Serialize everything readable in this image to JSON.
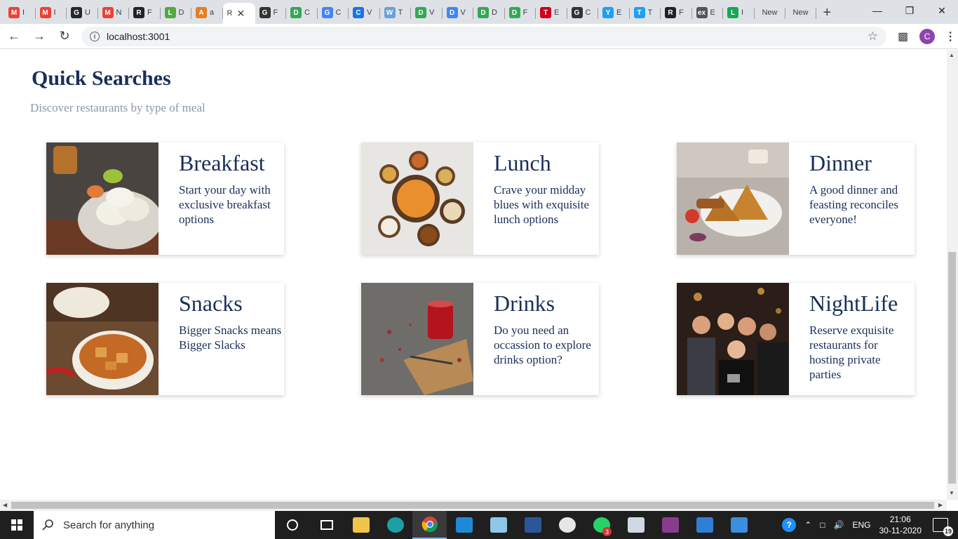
{
  "browser": {
    "tabs": [
      {
        "title": "I",
        "fav": "gmail-icon",
        "color": "#ea4335",
        "letter": "M"
      },
      {
        "title": "I",
        "fav": "gmail-icon",
        "color": "#ea4335",
        "letter": "M"
      },
      {
        "title": "U",
        "fav": "github-icon",
        "color": "#24292e",
        "letter": "G"
      },
      {
        "title": "N",
        "fav": "gmail-icon",
        "color": "#ea4335",
        "letter": "M"
      },
      {
        "title": "F",
        "fav": "react-icon",
        "color": "#20232a",
        "letter": "R"
      },
      {
        "title": "D",
        "fav": "mongodb-icon",
        "color": "#4faa41",
        "letter": "L"
      },
      {
        "title": "a",
        "fav": "grid-icon",
        "color": "#e67e22",
        "letter": "A"
      },
      {
        "title": "R",
        "fav": "none",
        "color": "#ffffff",
        "letter": "",
        "active": true
      },
      {
        "title": "F",
        "fav": "globe-icon",
        "color": "#333333",
        "letter": "G"
      },
      {
        "title": "C",
        "fav": "drive-icon",
        "color": "#34a853",
        "letter": "D"
      },
      {
        "title": "C",
        "fav": "google-icon",
        "color": "#4285f4",
        "letter": "G"
      },
      {
        "title": "V",
        "fav": "contacts-icon",
        "color": "#1a73e8",
        "letter": "C"
      },
      {
        "title": "T",
        "fav": "whiteboard-icon",
        "color": "#6aa0d8",
        "letter": "W"
      },
      {
        "title": "V",
        "fav": "drive-icon",
        "color": "#34a853",
        "letter": "D"
      },
      {
        "title": "V",
        "fav": "docs-icon",
        "color": "#4285f4",
        "letter": "D"
      },
      {
        "title": "D",
        "fav": "drive-icon",
        "color": "#34a853",
        "letter": "D"
      },
      {
        "title": "F",
        "fav": "drive-icon",
        "color": "#34a853",
        "letter": "D"
      },
      {
        "title": "E",
        "fav": "tools-icon",
        "color": "#d0021b",
        "letter": "T"
      },
      {
        "title": "C",
        "fav": "globe-icon",
        "color": "#333333",
        "letter": "G"
      },
      {
        "title": "E",
        "fav": "bolt-icon",
        "color": "#1da1f2",
        "letter": "Y"
      },
      {
        "title": "T",
        "fav": "t-icon",
        "color": "#1da1f2",
        "letter": "T"
      },
      {
        "title": "F",
        "fav": "react-icon",
        "color": "#20232a",
        "letter": "R"
      },
      {
        "title": "E",
        "fav": "express-icon",
        "color": "#555555",
        "letter": "ex"
      },
      {
        "title": "I",
        "fav": "mongodb-icon",
        "color": "#13aa52",
        "letter": "L"
      }
    ],
    "new_tabs": [
      "New",
      "New"
    ],
    "url": "localhost:3001",
    "profile_initial": "C"
  },
  "page": {
    "title": "Quick Searches",
    "subtitle": "Discover restaurants by type of meal",
    "cards": [
      {
        "title": "Breakfast",
        "desc": "Start your day with exclusive breakfast options",
        "image": "breakfast-photo"
      },
      {
        "title": "Lunch",
        "desc": "Crave your midday blues with exquisite lunch options",
        "image": "lunch-photo"
      },
      {
        "title": "Dinner",
        "desc": "A good dinner and feasting reconciles everyone!",
        "image": "dinner-photo"
      },
      {
        "title": "Snacks",
        "desc": "Bigger Snacks means Bigger Slacks",
        "image": "snacks-photo"
      },
      {
        "title": "Drinks",
        "desc": "Do you need an occassion to explore drinks option?",
        "image": "drinks-photo"
      },
      {
        "title": "NightLife",
        "desc": "Reserve exquisite restaurants for hosting private parties",
        "image": "nightlife-photo"
      }
    ]
  },
  "taskbar": {
    "search_placeholder": "Search for anything",
    "apps": [
      "task-view-icon",
      "file-explorer-icon",
      "edge-icon",
      "chrome-icon",
      "vscode-icon",
      "notepad-icon",
      "word-icon",
      "paint-icon",
      "whatsapp-icon",
      "screen-icon",
      "winrar-icon",
      "media-icon",
      "photos-icon"
    ],
    "whatsapp_badge": "3",
    "language": "ENG",
    "time": "21:06",
    "date": "30-11-2020",
    "notifications": "19"
  }
}
